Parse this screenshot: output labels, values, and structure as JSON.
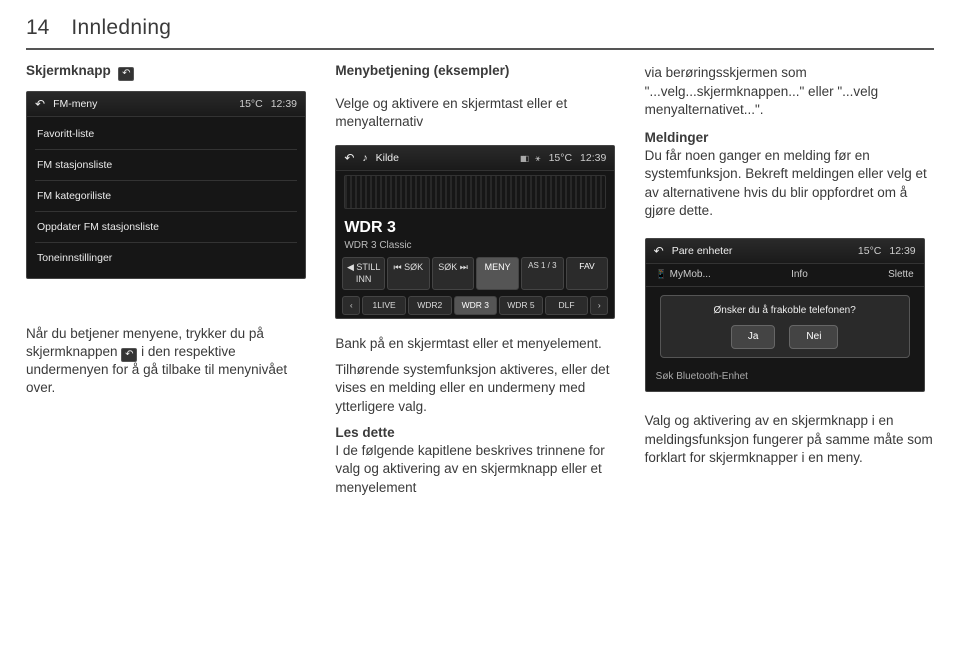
{
  "page": {
    "number": "14",
    "title": "Innledning"
  },
  "col1": {
    "label_skjermknapp": "Skjermknapp",
    "shot1": {
      "title": "FM-meny",
      "temp": "15°C",
      "time": "12:39",
      "items": [
        "Favoritt-liste",
        "FM stasjonsliste",
        "FM kategoriliste",
        "Oppdater FM stasjonsliste",
        "Toneinnstillinger"
      ]
    },
    "para1a": "Når du betjener menyene, trykker du på skjermknappen ",
    "para1b": " i den respektive undermenyen for å gå tilbake til menynivået over."
  },
  "col2": {
    "heading": "Menybetjening (eksempler)",
    "lead": "Velge og aktivere en skjermtast eller et menyalternativ",
    "shot2": {
      "kilde": "Kilde",
      "temp": "15°C",
      "time": "12:39",
      "station": "WDR 3",
      "subtitle": "WDR 3 Classic",
      "buttons": [
        "STILL INN",
        "SØK",
        "SØK",
        "MENY"
      ],
      "as": "AS 1 / 3",
      "fav": "FAV",
      "presets": [
        "1LIVE",
        "WDR2",
        "WDR 3",
        "WDR 5",
        "DLF"
      ]
    },
    "p1": "Bank på en skjermtast eller et menyelement.",
    "p2": "Tilhørende systemfunksjon aktiveres, eller det vises en melding eller en undermeny med ytterligere valg.",
    "les_dette": "Les dette",
    "p3": "I de følgende kapitlene beskrives trinnene for valg og aktivering av en skjermknapp eller et menyelement"
  },
  "col3": {
    "p1": "via berøringsskjermen som \"...velg...skjermknappen...\" eller \"...velg menyalternativet...\".",
    "meldinger": "Meldinger",
    "p2": "Du får noen ganger en melding før en systemfunksjon. Bekreft meldingen eller velg et av alternativene hvis du blir oppfordret om å gjøre dette.",
    "shot3": {
      "title": "Pare enheter",
      "temp": "15°C",
      "time": "12:39",
      "row": {
        "left": "MyMob...",
        "mid": "Info",
        "right": "Slette"
      },
      "dialog_text": "Ønsker du å frakoble telefonen?",
      "yes": "Ja",
      "no": "Nei",
      "footer": "Søk Bluetooth-Enhet"
    },
    "p3": "Valg og aktivering av en skjermknapp i en meldingsfunksjon fungerer på samme måte som forklart for skjermknapper i en meny."
  }
}
